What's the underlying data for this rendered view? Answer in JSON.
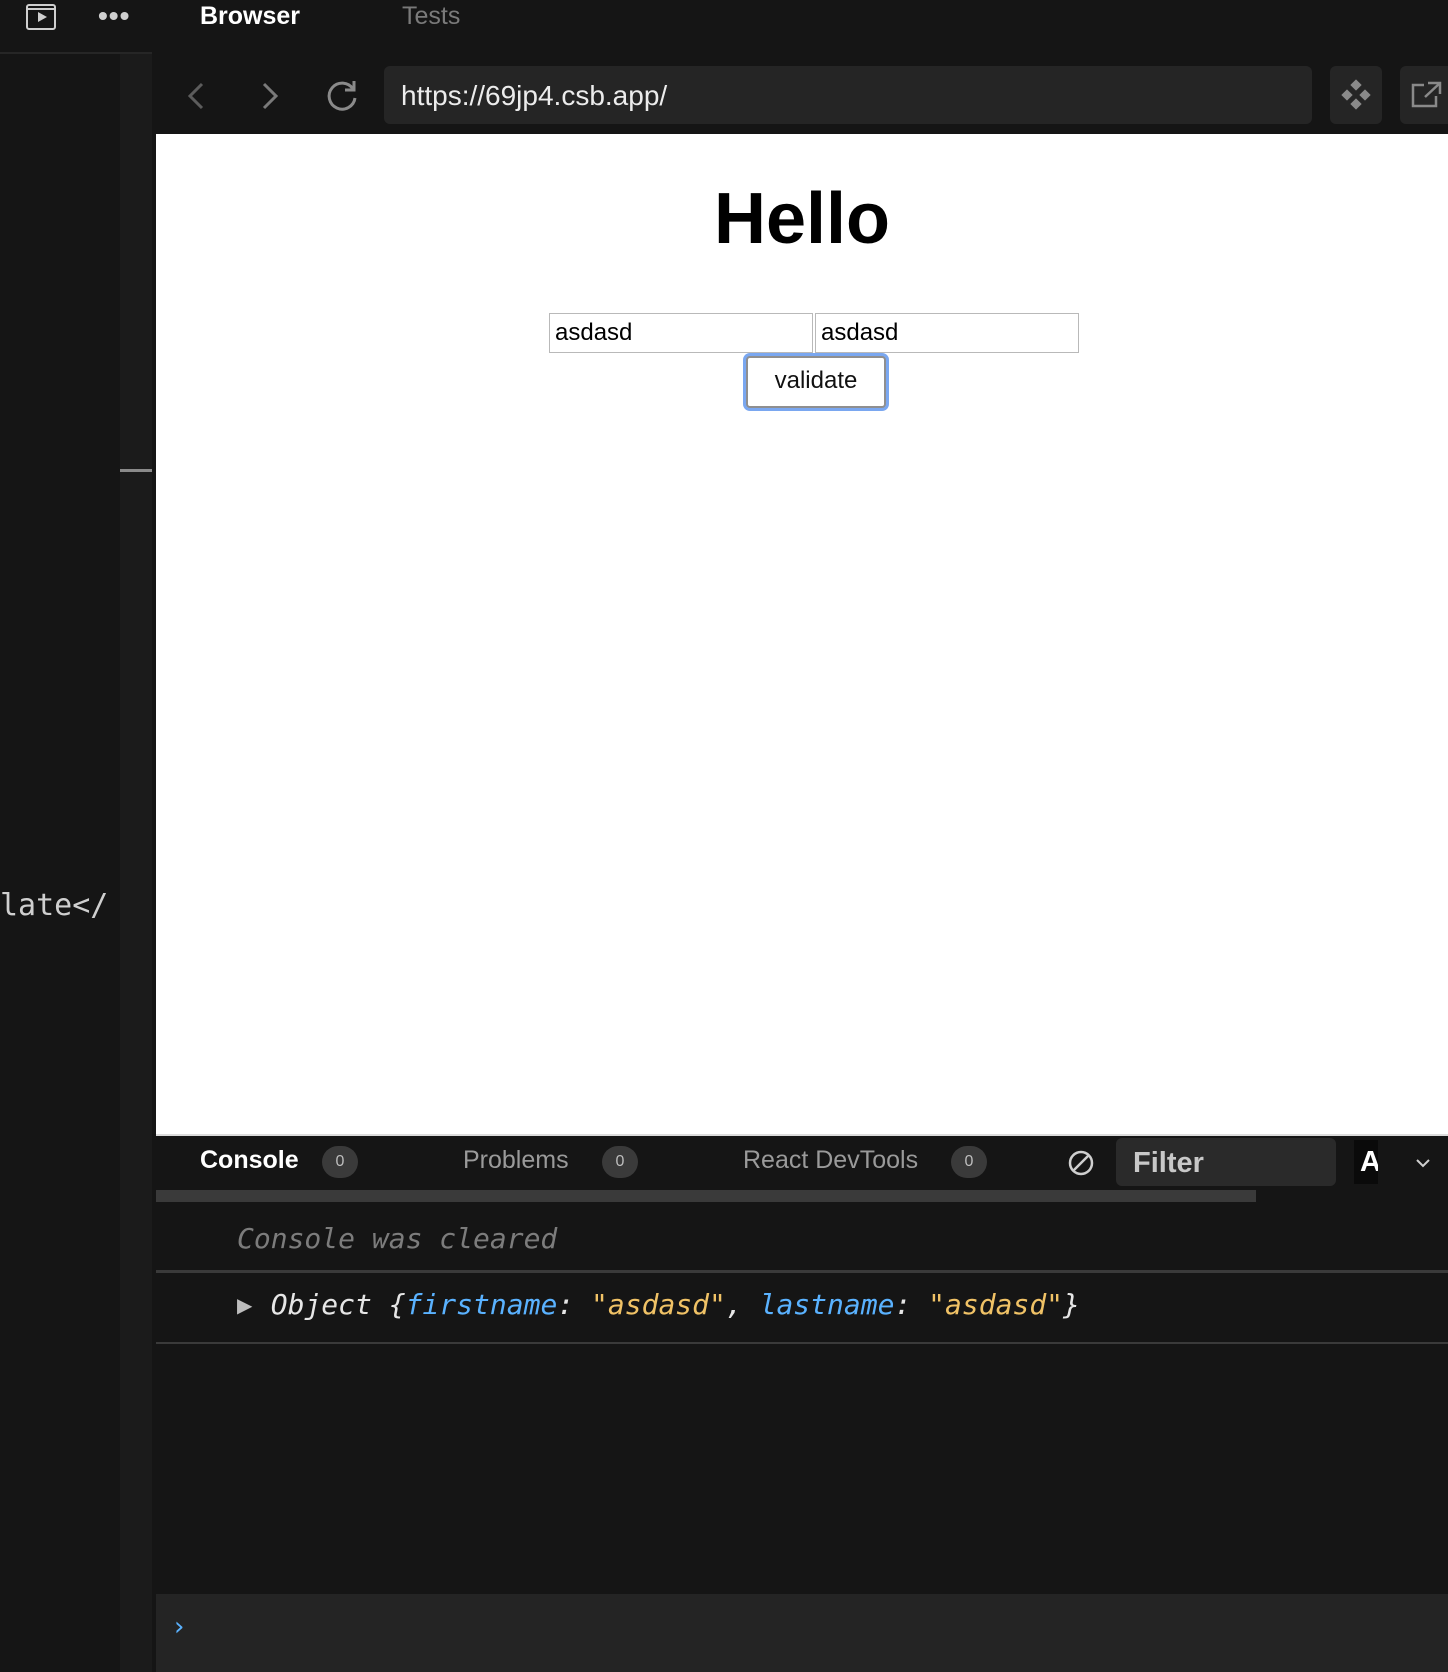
{
  "editor": {
    "code_fragment": "late</"
  },
  "top_tabs": {
    "browser": "Browser",
    "tests": "Tests"
  },
  "navbar": {
    "url": "https://69jp4.csb.app/"
  },
  "preview": {
    "title": "Hello",
    "firstname_value": "asdasd",
    "lastname_value": "asdasd",
    "validate_label": "validate"
  },
  "console_panel": {
    "tabs": [
      {
        "label": "Console",
        "count": "0"
      },
      {
        "label": "Problems",
        "count": "0"
      },
      {
        "label": "React DevTools",
        "count": "0"
      }
    ],
    "filter_placeholder": "Filter",
    "level_select": "A",
    "cleared_message": "Console was cleared",
    "log": {
      "prefix": "Object {",
      "key1": "firstname",
      "value1": "\"asdasd\"",
      "key2": "lastname",
      "value2": "\"asdasd\"",
      "suffix": "}"
    }
  },
  "colors": {
    "accent": "#5ab2ff",
    "string": "#f0c266",
    "focus_ring": "#7aa7f0"
  }
}
